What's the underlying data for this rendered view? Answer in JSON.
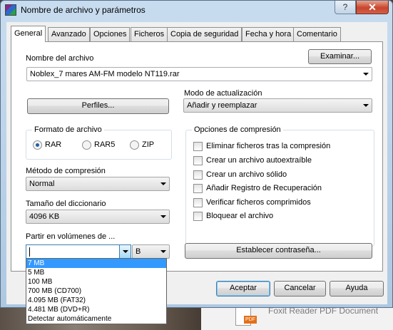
{
  "window": {
    "title": "Nombre de archivo y parámetros",
    "help_glyph": "?",
    "close_glyph": "✕",
    "app_icon": "winrar-icon"
  },
  "tabs": [
    {
      "label": "General",
      "active": true
    },
    {
      "label": "Avanzado"
    },
    {
      "label": "Opciones"
    },
    {
      "label": "Ficheros"
    },
    {
      "label": "Copia de seguridad"
    },
    {
      "label": "Fecha y hora"
    },
    {
      "label": "Comentario"
    }
  ],
  "archive_name": {
    "label": "Nombre del archivo",
    "browse_button": "Examinar...",
    "value": "Noblex_7 mares  AM-FM modelo NT119.rar"
  },
  "profiles_button": "Perfiles...",
  "update_mode": {
    "label": "Modo de actualización",
    "value": "Añadir y reemplazar"
  },
  "archive_format": {
    "title": "Formato de archivo",
    "options": [
      {
        "label": "RAR",
        "selected": true
      },
      {
        "label": "RAR5",
        "selected": false
      },
      {
        "label": "ZIP",
        "selected": false
      }
    ]
  },
  "compression_method": {
    "label": "Método de compresión",
    "value": "Normal"
  },
  "dictionary_size": {
    "label": "Tamaño del diccionario",
    "value": "4096 KB"
  },
  "split_volumes": {
    "label": "Partir en volúmenes de ...",
    "value": "",
    "unit": "B",
    "options": [
      "7 MB",
      "5 MB",
      "100 MB",
      "700 MB   (CD700)",
      "4.095 MB   (FAT32)",
      "4.481 MB   (DVD+R)",
      "Detectar automáticamente"
    ],
    "highlighted_index": 0
  },
  "compression_options": {
    "title": "Opciones de compresión",
    "items": [
      {
        "label": "Eliminar ficheros tras la compresión",
        "checked": false
      },
      {
        "label": "Crear un archivo autoextraíble",
        "checked": false
      },
      {
        "label": "Crear un archivo sólido",
        "checked": false
      },
      {
        "label": "Añadir Registro de Recuperación",
        "checked": false
      },
      {
        "label": "Verificar ficheros comprimidos",
        "checked": false
      },
      {
        "label": "Bloquear el archivo",
        "checked": false
      }
    ]
  },
  "set_password_button": "Establecer contraseña...",
  "footer": {
    "ok": "Aceptar",
    "cancel": "Cancelar",
    "help": "Ayuda"
  },
  "background": {
    "taskbar_item": "Foxit Reader PDF Document",
    "badge": "PDF"
  },
  "colors": {
    "selection": "#3399ff",
    "close_button": "#c9452c",
    "focus_border": "#3c7fb1"
  }
}
